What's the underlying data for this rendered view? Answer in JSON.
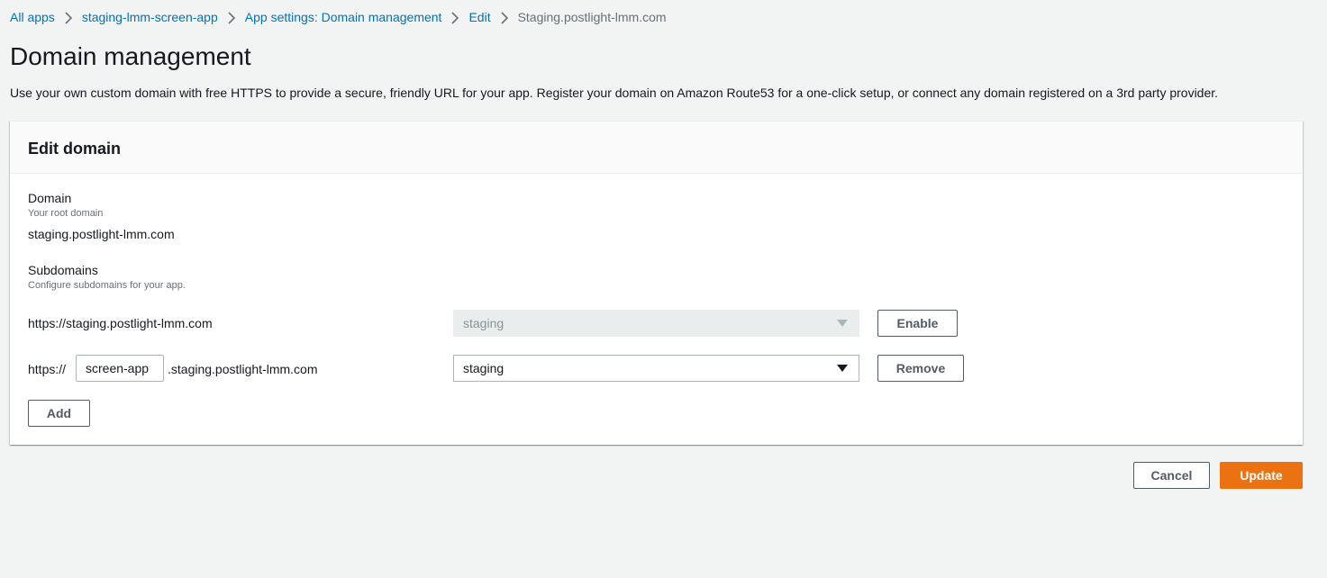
{
  "breadcrumb": {
    "items": [
      {
        "label": "All apps"
      },
      {
        "label": "staging-lmm-screen-app"
      },
      {
        "label": "App settings: Domain management"
      },
      {
        "label": "Edit"
      },
      {
        "label": "Staging.postlight-lmm.com"
      }
    ]
  },
  "page": {
    "title": "Domain management",
    "description": "Use your own custom domain with free HTTPS to provide a secure, friendly URL for your app. Register your domain on Amazon Route53 for a one-click setup, or connect any domain registered on a 3rd party provider."
  },
  "panel": {
    "title": "Edit domain",
    "domain": {
      "label": "Domain",
      "description": "Your root domain",
      "value": "staging.postlight-lmm.com"
    },
    "subdomains": {
      "label": "Subdomains",
      "description": "Configure subdomains for your app.",
      "rows": [
        {
          "url": "https://staging.postlight-lmm.com",
          "branch": "staging",
          "action": "Enable"
        },
        {
          "prefix": "https://",
          "subdomain_value": "screen-app",
          "suffix": ".staging.postlight-lmm.com",
          "branch": "staging",
          "action": "Remove"
        }
      ]
    },
    "add_label": "Add"
  },
  "footer": {
    "cancel_label": "Cancel",
    "update_label": "Update"
  },
  "colors": {
    "link": "#0073bb",
    "primary": "#ec7211",
    "background": "#f2f3f3"
  }
}
